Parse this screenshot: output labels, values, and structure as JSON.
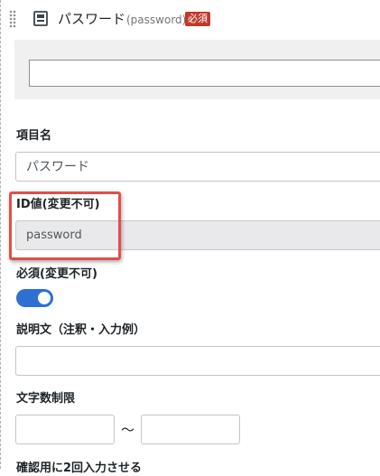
{
  "field": {
    "title": "パスワード",
    "subtitle": "(password)",
    "required_badge": "必須",
    "icon": "form-field-icon"
  },
  "settings": {
    "item_name_label": "項目名",
    "item_name_value": "パスワード",
    "id_label": "ID値(変更不可)",
    "id_value": "password",
    "required_label": "必須(変更不可)",
    "required_on": true,
    "description_label": "説明文（注釈・入力例）",
    "description_value": "",
    "char_limit_label": "文字数制限",
    "char_limit_min": "",
    "char_limit_max": "",
    "char_limit_separator": "～",
    "confirm_label": "確認用に2回入力させる"
  },
  "colors": {
    "toggle_on": "#2f6fd3",
    "badge": "#c0392b",
    "highlight": "#e0504a"
  }
}
